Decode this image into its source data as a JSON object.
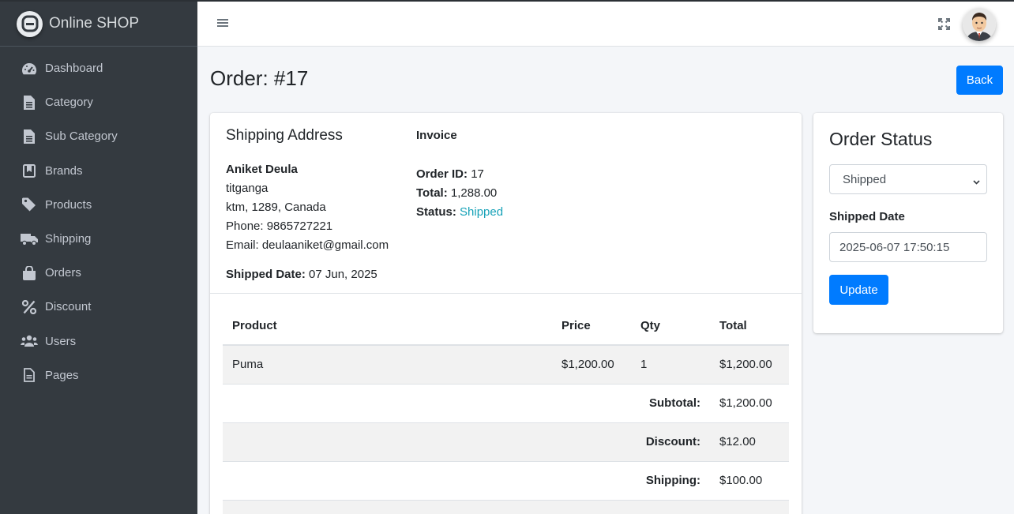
{
  "brand": {
    "name": "Online SHOP",
    "logo_icon": "adminlte-logo-icon"
  },
  "sidebar": {
    "items": [
      {
        "label": "Dashboard",
        "icon": "tachometer-icon"
      },
      {
        "label": "Category",
        "icon": "file-icon"
      },
      {
        "label": "Sub Category",
        "icon": "file-icon"
      },
      {
        "label": "Brands",
        "icon": "bookmark-icon"
      },
      {
        "label": "Products",
        "icon": "tag-icon"
      },
      {
        "label": "Shipping",
        "icon": "truck-icon"
      },
      {
        "label": "Orders",
        "icon": "shopping-bag-icon"
      },
      {
        "label": "Discount",
        "icon": "percent-icon"
      },
      {
        "label": "Users",
        "icon": "users-icon"
      },
      {
        "label": "Pages",
        "icon": "file-alt-icon"
      }
    ]
  },
  "header": {
    "menu_icon": "hamburger-icon",
    "fullscreen_icon": "expand-icon",
    "avatar_icon": "user-avatar"
  },
  "page": {
    "title": "Order: #17",
    "back_label": "Back"
  },
  "shipping": {
    "title": "Shipping Address",
    "name": "Aniket Deula",
    "line1": "titganga",
    "line2": "ktm, 1289, Canada",
    "phone": "Phone: 9865727221",
    "email": "Email: deulaaniket@gmail.com",
    "shipped_date_label": "Shipped Date:",
    "shipped_date_value": "07 Jun, 2025"
  },
  "invoice": {
    "title": "Invoice",
    "order_id_label": "Order ID:",
    "order_id_value": "17",
    "total_label": "Total:",
    "total_value": "1,288.00",
    "status_label": "Status:",
    "status_value": "Shipped",
    "status_color": "#17a2b8"
  },
  "table": {
    "headers": [
      "Product",
      "Price",
      "Qty",
      "Total"
    ],
    "rows": [
      {
        "product": "Puma",
        "price": "$1,200.00",
        "qty": "1",
        "total": "$1,200.00"
      }
    ],
    "subtotal_label": "Subtotal:",
    "subtotal_value": "$1,200.00",
    "discount_label": "Discount:",
    "discount_value": "$12.00",
    "shipping_label": "Shipping:",
    "shipping_value": "$100.00"
  },
  "order_status": {
    "title": "Order Status",
    "selected": "Shipped",
    "shipped_date_label": "Shipped Date",
    "shipped_date_value": "2025-06-07 17:50:15",
    "update_label": "Update"
  },
  "colors": {
    "primary": "#007bff",
    "sidebar": "#343a40",
    "info": "#17a2b8"
  }
}
